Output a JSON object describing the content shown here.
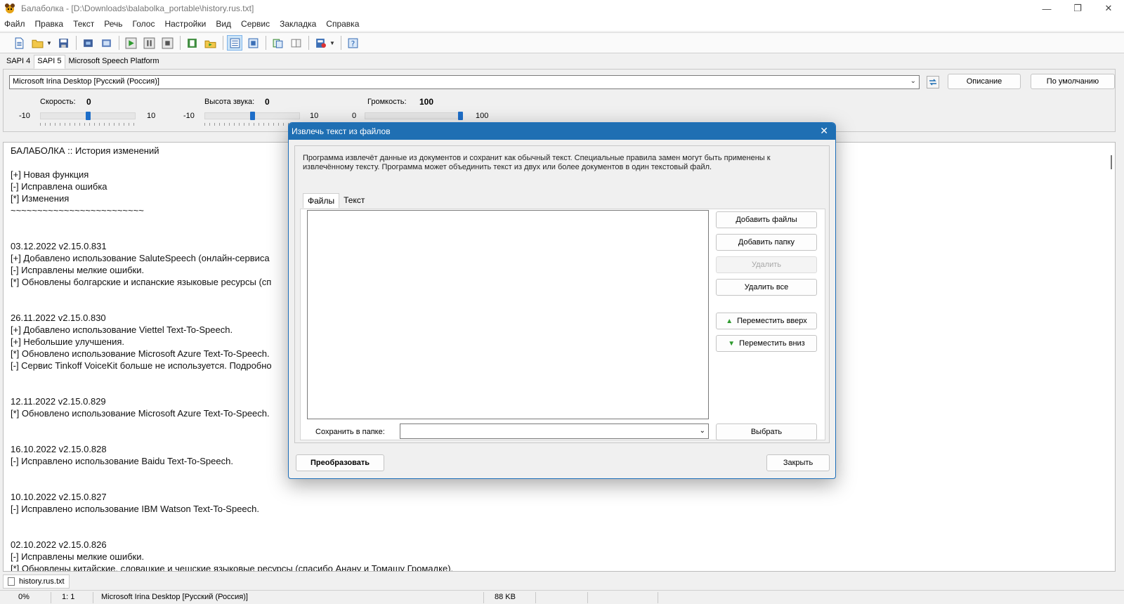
{
  "window": {
    "title": "Балаболка - [D:\\Downloads\\balabolka_portable\\history.rus.txt]",
    "controls": [
      "minimize-icon",
      "restore-icon",
      "close-icon"
    ]
  },
  "menu": [
    "Файл",
    "Правка",
    "Текст",
    "Речь",
    "Голос",
    "Настройки",
    "Вид",
    "Сервис",
    "Закладка",
    "Справка"
  ],
  "sapi_tabs": [
    "SAPI 4",
    "SAPI 5",
    "Microsoft Speech Platform"
  ],
  "voice": {
    "selected": "Microsoft Irina Desktop [Русский (Россия)]",
    "description_button": "Описание",
    "default_button": "По умолчанию",
    "rate": {
      "label": "Скорость:",
      "value": "0",
      "min": "-10",
      "max": "10",
      "level": 0.5
    },
    "pitch": {
      "label": "Высота звука:",
      "value": "0",
      "min": "-10",
      "max": "10",
      "level": 0.5
    },
    "volume": {
      "label": "Громкость:",
      "value": "100",
      "min": "0",
      "max": "100",
      "level": 1.0
    }
  },
  "text_lines": [
    "БАЛАБОЛКА :: История изменений",
    "",
    "[+] Новая функция",
    "[-] Исправлена ошибка",
    "[*] Изменения",
    "~~~~~~~~~~~~~~~~~~~~~~~~~",
    "",
    "",
    "03.12.2022    v2.15.0.831",
    "[+] Добавлено использование SaluteSpeech (онлайн-сервиса",
    "[-] Исправлены мелкие ошибки.",
    "[*] Обновлены болгарские и испанские языковые ресурсы (сп",
    "",
    "",
    "26.11.2022    v2.15.0.830",
    "[+] Добавлено использование Viettel Text-To-Speech.",
    "[+] Небольшие улучшения.",
    "[*] Обновлено использование Microsoft Azure Text-To-Speech.",
    "[-] Сервис Tinkoff VoiceKit больше не используется. Подробно",
    "",
    "",
    "12.11.2022    v2.15.0.829",
    "[*] Обновлено использование Microsoft Azure Text-To-Speech.",
    "",
    "",
    "16.10.2022    v2.15.0.828",
    "[-] Исправлено использование Baidu Text-To-Speech.",
    "",
    "",
    "10.10.2022    v2.15.0.827",
    "[-] Исправлено использование IBM Watson Text-To-Speech.",
    "",
    "",
    "02.10.2022    v2.15.0.826",
    "[-] Исправлены мелкие ошибки.",
    "[*] Обновлены китайские, словацкие и чешские языковые ресурсы (спасибо Анану и Томашу Громадке)."
  ],
  "doc_tab": "history.rus.txt",
  "status": {
    "progress": "0%",
    "position": "1:   1",
    "voice": "Microsoft Irina Desktop [Русский (Россия)]",
    "size": "88 KB"
  },
  "dialog": {
    "title": "Извлечь текст из файлов",
    "description": "Программа извлечёт данные из документов и сохранит как обычный текст. Специальные правила замен могут быть применены к извлечённому тексту. Программа может объединить текст из двух или более документов в один текстовый файл.",
    "tabs": [
      "Файлы",
      "Текст"
    ],
    "buttons": {
      "add_files": "Добавить файлы",
      "add_folder": "Добавить папку",
      "delete": "Удалить",
      "delete_all": "Удалить все",
      "move_up": "Переместить вверх",
      "move_down": "Переместить вниз",
      "browse": "Выбрать",
      "convert": "Преобразовать",
      "close": "Закрыть"
    },
    "save_folder_label": "Сохранить в папке:",
    "save_folder_value": ""
  },
  "colors": {
    "accent": "#1f6fb3",
    "slider_thumb": "#1e6ec8",
    "arrow_green": "#2e9a2e"
  }
}
